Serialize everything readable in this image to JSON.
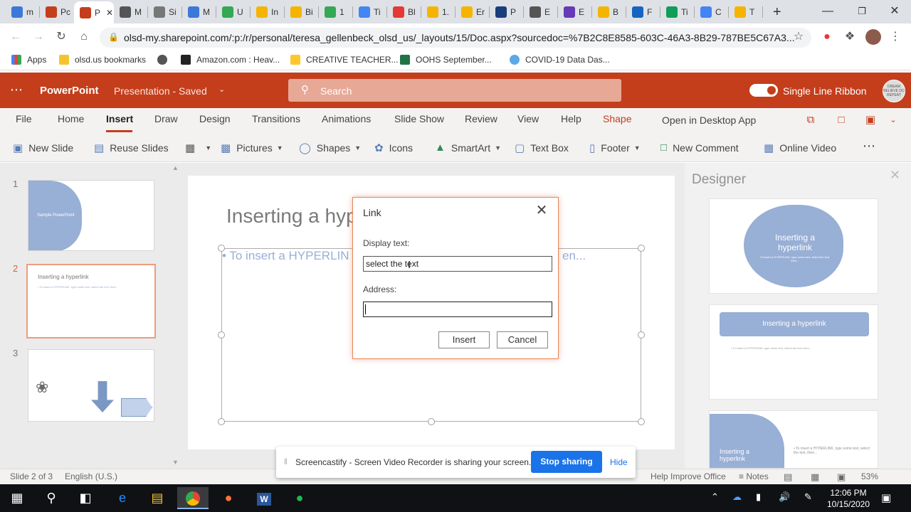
{
  "browser": {
    "tabs": [
      {
        "label": "m",
        "color": "#3c78d8",
        "icon": "circle-app-icon"
      },
      {
        "label": "Pc",
        "color": "#c43e1c",
        "icon": "powerpoint-icon"
      },
      {
        "label": "P",
        "color": "#c43e1c",
        "icon": "powerpoint-icon"
      },
      {
        "label": "M",
        "color": "#555555",
        "icon": "s-app-icon"
      },
      {
        "label": "Si",
        "color": "#777777",
        "icon": "globe-icon"
      },
      {
        "label": "M",
        "color": "#3c78d8",
        "icon": "outlook-icon"
      },
      {
        "label": "U",
        "color": "#34a853",
        "icon": "drive-icon"
      },
      {
        "label": "In",
        "color": "#f4b400",
        "icon": "slides-icon"
      },
      {
        "label": "Bi",
        "color": "#f4b400",
        "icon": "slides-icon"
      },
      {
        "label": "1",
        "color": "#34a853",
        "icon": "drive-icon"
      },
      {
        "label": "Ti",
        "color": "#4285f4",
        "icon": "docs-icon"
      },
      {
        "label": "Bl",
        "color": "#e53935",
        "icon": "ct-icon"
      },
      {
        "label": "1.",
        "color": "#f4b400",
        "icon": "slides-icon"
      },
      {
        "label": "Er",
        "color": "#f4b400",
        "icon": "slides-icon"
      },
      {
        "label": "P",
        "color": "#1a3d7c",
        "icon": "sis-icon"
      },
      {
        "label": "E",
        "color": "#555555",
        "icon": "s-app-icon"
      },
      {
        "label": "E",
        "color": "#673ab7",
        "icon": "forms-icon"
      },
      {
        "label": "B",
        "color": "#f4b400",
        "icon": "slides-icon"
      },
      {
        "label": "F",
        "color": "#1565c0",
        "icon": "s-blue-icon"
      },
      {
        "label": "Ti",
        "color": "#0f9d58",
        "icon": "sheets-icon"
      },
      {
        "label": "C",
        "color": "#4285f4",
        "icon": "google-icon"
      },
      {
        "label": "T",
        "color": "#f4b400",
        "icon": "slides-icon"
      }
    ],
    "url": "olsd-my.sharepoint.com/:p:/r/personal/teresa_gellenbeck_olsd_us/_layouts/15/Doc.aspx?sourcedoc=%7B2C8E8585-603C-46A3-8B29-787BE5C67A3...",
    "bookmarks": [
      "Apps",
      "olsd.us bookmarks",
      "",
      "Amazon.com : Heav...",
      "CREATIVE TEACHER...",
      "OOHS September...",
      "COVID-19 Data Das..."
    ]
  },
  "ppt": {
    "app_name": "PowerPoint",
    "doc_title": "Presentation  -  Saved",
    "search_placeholder": "Search",
    "single_line_ribbon": "Single Line Ribbon",
    "avatar_text": "DREAM BELIEVE DO REPEAT",
    "tabs": [
      "File",
      "Home",
      "Insert",
      "Draw",
      "Design",
      "Transitions",
      "Animations",
      "Slide Show",
      "Review",
      "View",
      "Help",
      "Shape"
    ],
    "open_desktop": "Open in Desktop App",
    "commands": {
      "new_slide": "New Slide",
      "reuse_slides": "Reuse Slides",
      "pictures": "Pictures",
      "shapes": "Shapes",
      "icons": "Icons",
      "smartart": "SmartArt",
      "text_box": "Text Box",
      "footer": "Footer",
      "new_comment": "New Comment",
      "online_video": "Online Video"
    },
    "thumbs": {
      "n1": "1",
      "n2": "2",
      "n3": "3",
      "t1_text": "Sample PowerPoint",
      "t2_title": "Inserting a hyperlink",
      "t2_body": "• To insert a HYPERLINK, type some text, select the text, then..."
    },
    "slide": {
      "title": "Inserting a hyp",
      "bullet": "• To insert a HYPERLIN",
      "bullet_tail": "en..."
    },
    "designer": {
      "title": "Designer",
      "card1_title": "Inserting a hyperlink",
      "card1_body": "To insert a HYPERLINK, type some text, select the text, then...",
      "card2_title": "Inserting a hyperlink",
      "card2_body": "• To insert a HYPERLINK, type some text, select the text, then...",
      "card3_title": "Inserting a hyperlink",
      "card3_body": "• To insert a HYPERLINK, type some text, select the text, then..."
    },
    "status": {
      "slide_count": "Slide 2 of 3",
      "language": "English (U.S.)",
      "help": "Help Improve Office",
      "notes": "Notes",
      "zoom": "53%"
    }
  },
  "dialog": {
    "title": "Link",
    "display_label": "Display text:",
    "display_value": "select the text",
    "address_label": "Address:",
    "address_value": "",
    "insert": "Insert",
    "cancel": "Cancel"
  },
  "screencastify": {
    "message": "Screencastify - Screen Video Recorder is sharing your screen.",
    "stop": "Stop sharing",
    "hide": "Hide"
  },
  "taskbar": {
    "time": "12:06 PM",
    "date": "10/15/2020"
  }
}
